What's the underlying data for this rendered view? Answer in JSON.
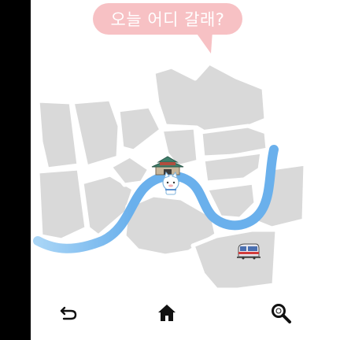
{
  "speech_bubble": {
    "text": "오늘 어디 갈래?"
  },
  "colors": {
    "bubble": "#f7c1c4",
    "district": "#d9d9d9",
    "river": "#6ab0ec",
    "river_light": "#9fcff5"
  },
  "map": {
    "landmarks": [
      {
        "name": "palace-gate",
        "icon": "palace-gate-icon"
      },
      {
        "name": "mascot",
        "icon": "cat-mascot-icon"
      },
      {
        "name": "train-station",
        "icon": "train-icon"
      }
    ]
  },
  "nav": {
    "back_icon": "back-arrow-icon",
    "home_icon": "home-icon",
    "search_icon": "search-icon"
  }
}
